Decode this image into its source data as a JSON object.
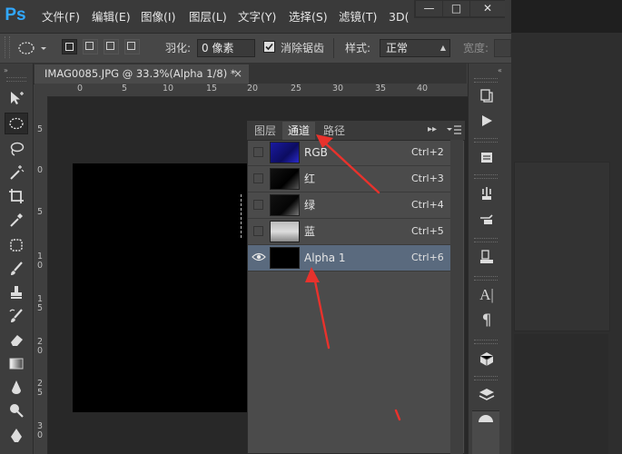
{
  "app": {
    "logo": "Ps"
  },
  "menu": [
    "文件(F)",
    "编辑(E)",
    "图像(I)",
    "图层(L)",
    "文字(Y)",
    "选择(S)",
    "滤镜(T)",
    "3D("
  ],
  "window_controls": [
    "—",
    "□",
    "✕"
  ],
  "options": {
    "feather_label": "羽化:",
    "feather_value": "0 像素",
    "antialias_label": "消除锯齿",
    "antialias_checked": true,
    "style_label": "样式:",
    "style_value": "正常",
    "width_label": "宽度:"
  },
  "document": {
    "tab_title": "IMAG0085.JPG @ 33.3%(Alpha 1/8) *",
    "ruler_top": [
      "0",
      "5",
      "10",
      "15",
      "20",
      "25",
      "30",
      "35",
      "40"
    ],
    "ruler_left": [
      "5",
      "0",
      "5",
      "1\n0",
      "1\n5",
      "2\n0",
      "2\n5",
      "3\n0"
    ]
  },
  "panel": {
    "tabs": [
      "图层",
      "通道",
      "路径"
    ],
    "active_tab": "通道",
    "channels": [
      {
        "name": "RGB",
        "shortcut": "Ctrl+2",
        "visible": false,
        "selected": false
      },
      {
        "name": "红",
        "shortcut": "Ctrl+3",
        "visible": false,
        "selected": false
      },
      {
        "name": "绿",
        "shortcut": "Ctrl+4",
        "visible": false,
        "selected": false
      },
      {
        "name": "蓝",
        "shortcut": "Ctrl+5",
        "visible": false,
        "selected": false
      },
      {
        "name": "Alpha 1",
        "shortcut": "Ctrl+6",
        "visible": true,
        "selected": true
      }
    ]
  },
  "icons": {
    "eye": "eye-icon",
    "panel_menu": "panel-menu-icon",
    "collapse": "double-chevron-icon"
  },
  "colors": {
    "ps_blue": "#31a8ff",
    "selected_row": "#5a6a7e",
    "annotation_arrow": "#e8322c"
  }
}
